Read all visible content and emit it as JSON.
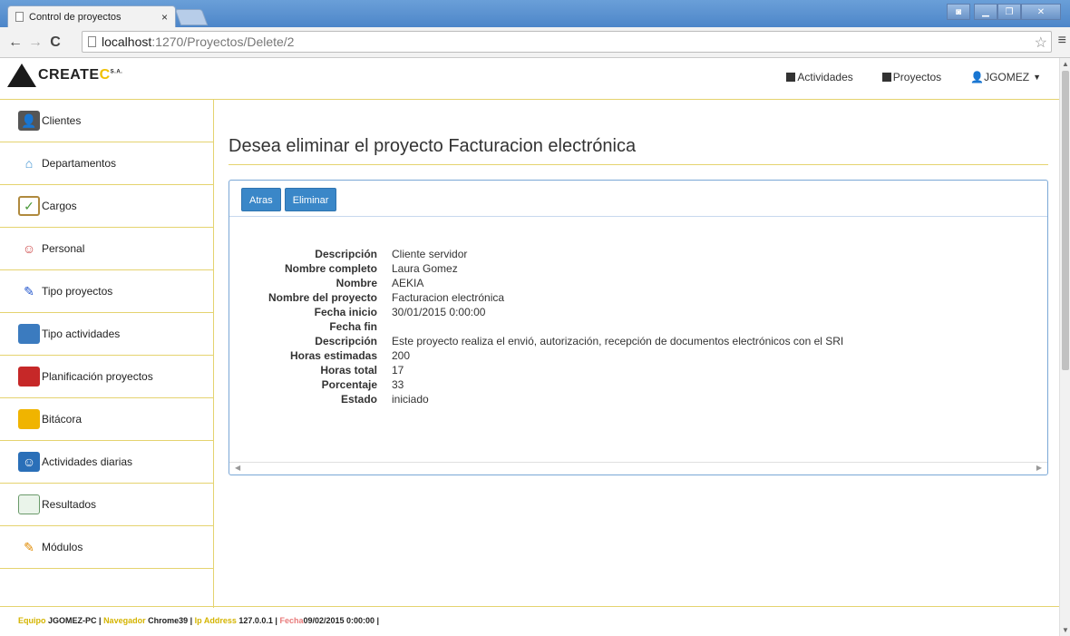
{
  "browser": {
    "tab_title": "Control de proyectos",
    "tab_close": "×",
    "url_host": "localhost",
    "url_path": ":1270/Proyectos/Delete/2"
  },
  "navbar": {
    "logo_main": "CREATE",
    "logo_accent": "C",
    "logo_suffix": "S.A.",
    "links": [
      {
        "label": "Actividades"
      },
      {
        "label": "Proyectos"
      },
      {
        "label": "JGOMEZ"
      }
    ]
  },
  "sidebar": {
    "items": [
      {
        "label": "Clientes",
        "icon": "client-icon"
      },
      {
        "label": "Departamentos",
        "icon": "house-icon"
      },
      {
        "label": "Cargos",
        "icon": "clipboard-icon"
      },
      {
        "label": "Personal",
        "icon": "people-icon"
      },
      {
        "label": "Tipo proyectos",
        "icon": "project-type-icon"
      },
      {
        "label": "Tipo actividades",
        "icon": "folder-blue-icon"
      },
      {
        "label": "Planificación proyectos",
        "icon": "toolbox-icon"
      },
      {
        "label": "Bitácora",
        "icon": "folder-icon"
      },
      {
        "label": "Actividades diarias",
        "icon": "messenger-icon"
      },
      {
        "label": "Resultados",
        "icon": "spreadsheet-icon"
      },
      {
        "label": "Módulos",
        "icon": "pencil-icon"
      }
    ]
  },
  "main": {
    "title": "Desea eliminar el proyecto Facturacion electrónica",
    "buttons": {
      "back": "Atras",
      "delete": "Eliminar"
    },
    "details": [
      {
        "k": "Descripción",
        "v": "Cliente servidor"
      },
      {
        "k": "Nombre completo",
        "v": "Laura Gomez"
      },
      {
        "k": "Nombre",
        "v": "AEKIA"
      },
      {
        "k": "Nombre del proyecto",
        "v": "Facturacion electrónica"
      },
      {
        "k": "Fecha inicio",
        "v": "30/01/2015 0:00:00"
      },
      {
        "k": "Fecha fin",
        "v": ""
      },
      {
        "k": "Descripción",
        "v": "Este proyecto realiza el envió, autorización, recepción de documentos electrónicos con el SRI"
      },
      {
        "k": "Horas estimadas",
        "v": "200"
      },
      {
        "k": "Horas total",
        "v": "17"
      },
      {
        "k": "Porcentaje",
        "v": "33"
      },
      {
        "k": "Estado",
        "v": "iniciado"
      }
    ]
  },
  "footer": {
    "equipo_label": "Equipo",
    "equipo_value": "JGOMEZ-PC |",
    "navegador_label": "Navegador",
    "navegador_value": "Chrome39 |",
    "ip_label": "Ip Address",
    "ip_value": "127.0.0.1 |",
    "fecha_label": "Fecha",
    "fecha_value": "09/02/2015 0:00:00 |"
  }
}
